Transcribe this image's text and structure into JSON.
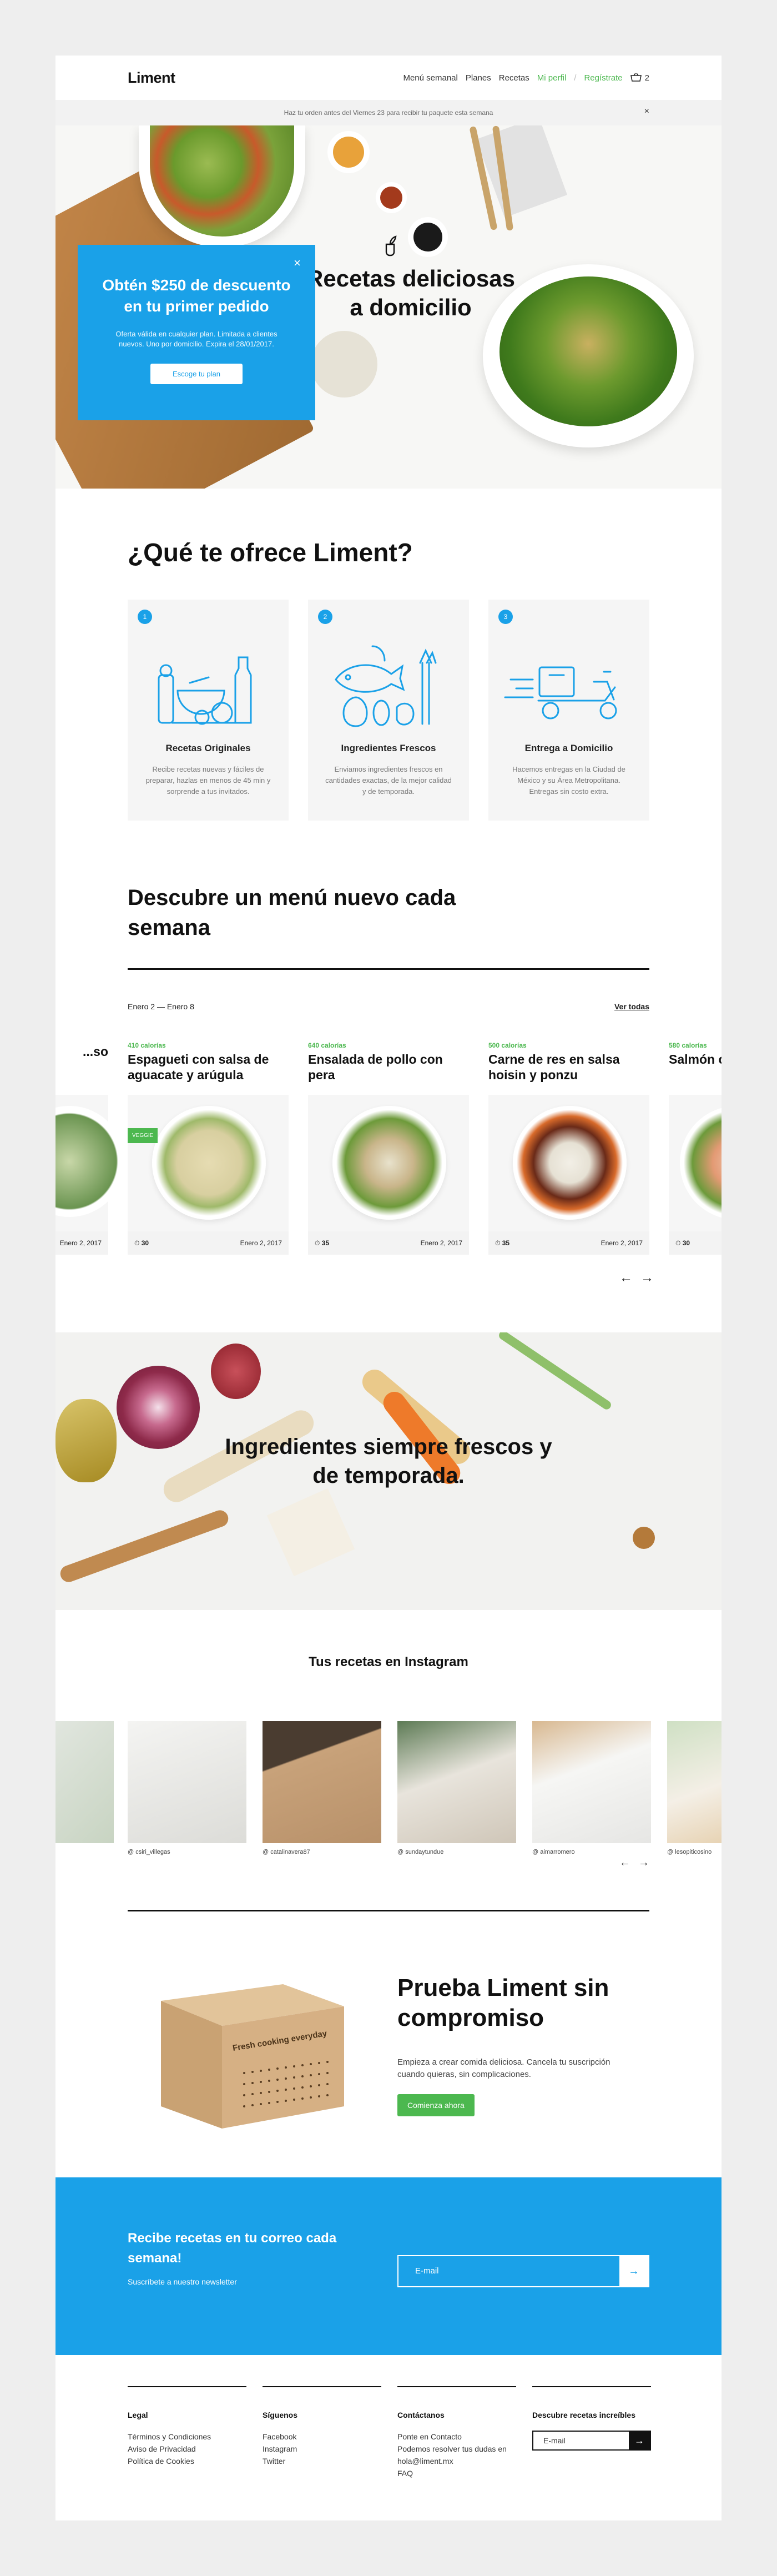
{
  "brand": "Liment",
  "nav": {
    "items": [
      "Menú semanal",
      "Planes",
      "Recetas"
    ],
    "profile": "Mi perfil",
    "separator": "/",
    "register": "Regístrate",
    "cart_count": "2"
  },
  "announcement": {
    "text": "Haz tu orden antes del Viernes 23 para recibir tu paquete esta semana",
    "close": "×"
  },
  "hero": {
    "title": "Recetas deliciosas a domicilio"
  },
  "promo": {
    "title": "Obtén $250 de descuento en tu primer pedido",
    "body": "Oferta válida en cualquier plan. Limitada a clientes nuevos. Uno por domicilio. Expira el 28/01/2017.",
    "button": "Escoge tu plan",
    "close": "×"
  },
  "offers": {
    "title": "¿Qué te ofrece Liment?",
    "cards": [
      {
        "num": "1",
        "icon": "cooking-utensils-icon",
        "title": "Recetas Originales",
        "text": "Recibe recetas nuevas y fáciles de preparar, hazlas en menos de 45 min y sorprende a tus invitados."
      },
      {
        "num": "2",
        "icon": "fresh-ingredients-icon",
        "title": "Ingredientes Frescos",
        "text": "Enviamos ingredientes frescos en cantidades exactas, de la mejor calidad y de temporada."
      },
      {
        "num": "3",
        "icon": "delivery-scooter-icon",
        "title": "Entrega a Domicilio",
        "text": "Hacemos entregas en la Ciudad de México y su Área Metropolitana. Entregas sin costo extra."
      }
    ]
  },
  "menu": {
    "title": "Descubre un menú nuevo cada semana",
    "date_from": "Enero 2",
    "date_sep": "—",
    "date_to": "Enero 8",
    "view_all": "Ver todas",
    "recipes": [
      {
        "calories": "",
        "name": "...so",
        "time": "",
        "date": "Enero 2, 2017"
      },
      {
        "calories": "410 calorías",
        "name": "Espagueti con salsa de aguacate y arúgula",
        "time": "30",
        "date": "Enero 2, 2017",
        "badge": "VEGGIE"
      },
      {
        "calories": "640 calorías",
        "name": "Ensalada de pollo con pera",
        "time": "35",
        "date": "Enero 2, 2017"
      },
      {
        "calories": "500 calorías",
        "name": "Carne de res en salsa hoisin y ponzu",
        "time": "35",
        "date": "Enero 2, 2017"
      },
      {
        "calories": "580 calorías",
        "name": "Salmón con ejotes al",
        "time": "30",
        "date": ""
      }
    ],
    "prev": "←",
    "next": "→"
  },
  "fresh": {
    "title": "Ingredientes siempre frescos y de temporada."
  },
  "instagram": {
    "title": "Tus recetas en Instagram",
    "posts": [
      {
        "user": ""
      },
      {
        "user": "@ csiri_villegas"
      },
      {
        "user": "@ catalinavera87"
      },
      {
        "user": "@ sundaytundue"
      },
      {
        "user": "@ aimarromero"
      },
      {
        "user": "@ lesopiticosino"
      }
    ],
    "prev": "←",
    "next": "→"
  },
  "trial": {
    "title": "Prueba Liment sin compromiso",
    "text": "Empieza a crear comida deliciosa. Cancela tu suscripción cuando quieras, sin complicaciones.",
    "button": "Comienza ahora",
    "box_label": "Fresh cooking everyday"
  },
  "newsletter": {
    "title": "Recibe recetas en tu correo cada semana!",
    "subtitle": "Suscríbete a nuestro newsletter",
    "placeholder": "E-mail",
    "submit": "→"
  },
  "footer": {
    "legal": {
      "title": "Legal",
      "links": [
        "Términos y Condiciones",
        "Aviso de Privacidad",
        "Política de Cookies"
      ]
    },
    "follow": {
      "title": "Síguenos",
      "links": [
        "Facebook",
        "Instagram",
        "Twitter"
      ]
    },
    "contact": {
      "title": "Contáctanos",
      "links": [
        "Ponte en Contacto",
        "Podemos resolver tus dudas en hola@liment.mx",
        "FAQ"
      ]
    },
    "discover": {
      "title": "Descubre recetas increíbles",
      "placeholder": "E-mail",
      "submit": "→"
    }
  },
  "colors": {
    "accent": "#1aa1e8",
    "green": "#4cb84f",
    "dark": "#111111"
  }
}
